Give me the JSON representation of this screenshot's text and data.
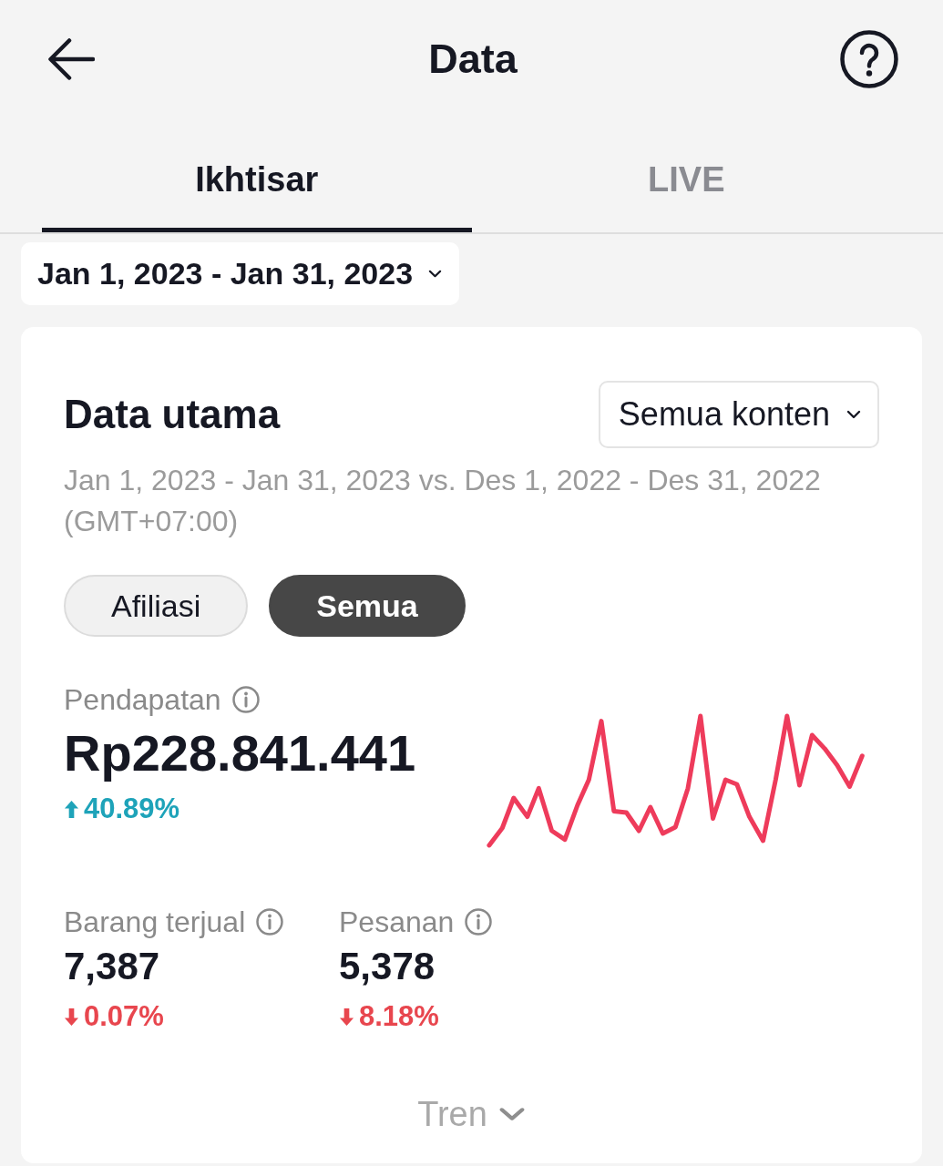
{
  "header": {
    "title": "Data"
  },
  "tabs": [
    {
      "label": "Ikhtisar",
      "selected": true
    },
    {
      "label": "LIVE",
      "selected": false
    }
  ],
  "date_range": {
    "label": "Jan 1, 2023 - Jan 31, 2023"
  },
  "card": {
    "title": "Data utama",
    "content_filter": "Semua konten",
    "comparison": "Jan 1, 2023 - Jan 31, 2023 vs. Des 1, 2022 - Des 31, 2022 (GMT+07:00)",
    "segments": [
      {
        "label": "Afiliasi",
        "selected": false
      },
      {
        "label": "Semua",
        "selected": true
      }
    ],
    "primary_metric": {
      "label": "Pendapatan",
      "value": "Rp228.841.441",
      "change": "40.89%",
      "increase": true
    },
    "metrics": [
      {
        "label": "Barang terjual",
        "value": "7,387",
        "change": "0.07%",
        "increase": false
      },
      {
        "label": "Pesanan",
        "value": "5,378",
        "change": "8.18%",
        "increase": false
      }
    ],
    "trend_toggle": {
      "label": "Tren",
      "expanded": false
    }
  }
}
